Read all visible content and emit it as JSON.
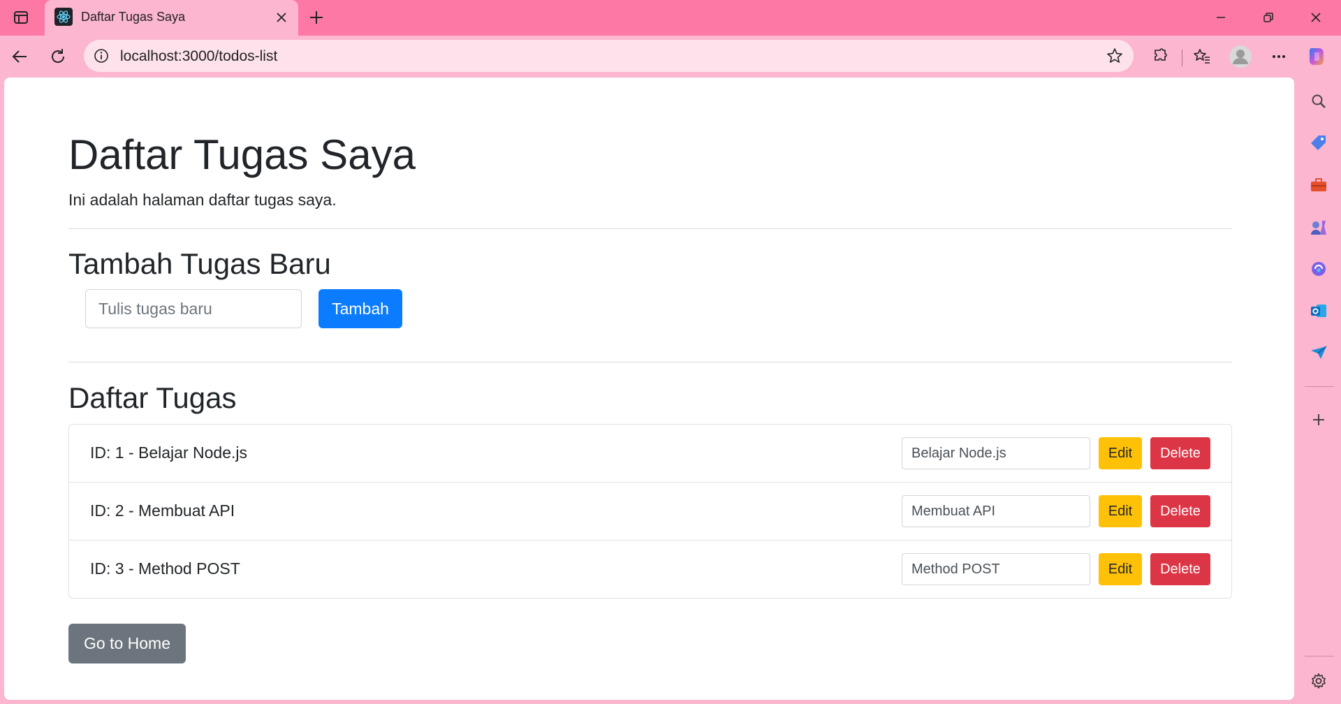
{
  "browser": {
    "tab_title": "Daftar Tugas Saya",
    "url": "localhost:3000/todos-list",
    "accent_color": "#fe78a6"
  },
  "page": {
    "title": "Daftar Tugas Saya",
    "subtitle": "Ini adalah halaman daftar tugas saya."
  },
  "add_section": {
    "heading": "Tambah Tugas Baru",
    "input_placeholder": "Tulis tugas baru",
    "input_value": "",
    "add_button": "Tambah"
  },
  "list_section": {
    "heading": "Daftar Tugas",
    "items": [
      {
        "label": "ID: 1 - Belajar Node.js",
        "edit_value": "Belajar Node.js",
        "edit_button": "Edit",
        "delete_button": "Delete"
      },
      {
        "label": "ID: 2 - Membuat API",
        "edit_value": "Membuat API",
        "edit_button": "Edit",
        "delete_button": "Delete"
      },
      {
        "label": "ID: 3 - Method POST",
        "edit_value": "Method POST",
        "edit_button": "Edit",
        "delete_button": "Delete"
      }
    ]
  },
  "home_button": "Go to Home",
  "sidebar_icons": [
    "search-icon",
    "shopping-tag-icon",
    "toolbox-icon",
    "games-icon",
    "copilot-icon",
    "outlook-icon",
    "send-icon",
    "add-icon",
    "settings-icon"
  ]
}
